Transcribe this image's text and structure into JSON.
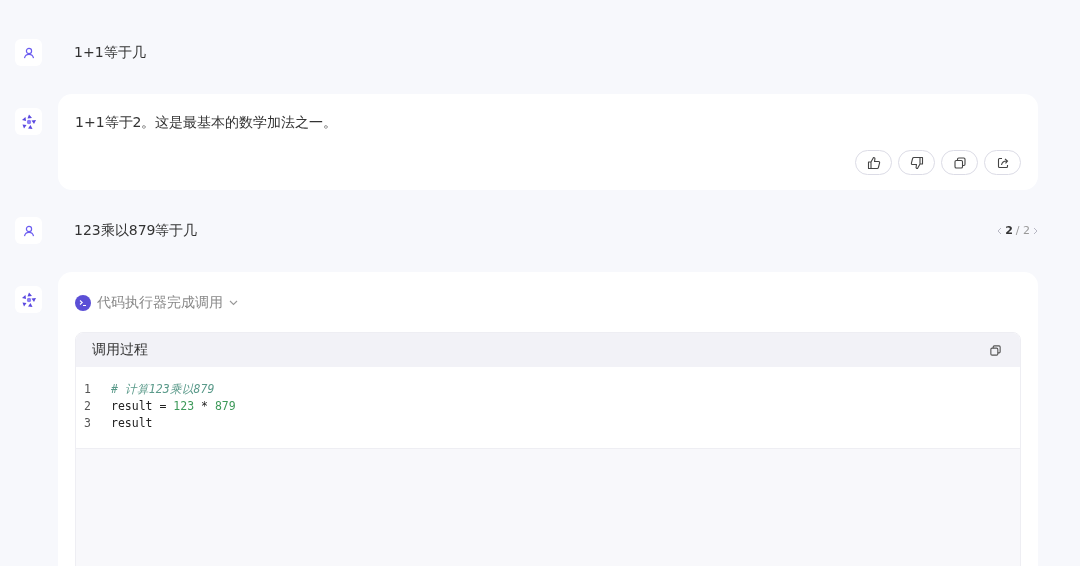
{
  "messages": [
    {
      "kind": "user",
      "text": "1+1等于几"
    },
    {
      "kind": "assistant",
      "text": "1+1等于2。这是最基本的数学加法之一。",
      "actions": [
        {
          "kind": "like"
        },
        {
          "kind": "dislike"
        },
        {
          "kind": "copy"
        },
        {
          "kind": "share"
        }
      ]
    },
    {
      "kind": "user",
      "text": "123乘以879等于几",
      "pager": {
        "current": "2",
        "total": "/ 2"
      }
    },
    {
      "kind": "assistant",
      "tool": {
        "status": "代码执行器完成调用",
        "expanded": true,
        "panel_title": "调用过程",
        "code": [
          {
            "number": "1",
            "tokens": [
              {
                "text": "# 计算123乘以879",
                "kind": "comment"
              }
            ]
          },
          {
            "number": "2",
            "tokens": [
              {
                "text": "result = ",
                "kind": "plain"
              },
              {
                "text": "123",
                "kind": "number"
              },
              {
                "text": " * ",
                "kind": "plain"
              },
              {
                "text": "879",
                "kind": "number"
              }
            ]
          },
          {
            "number": "3",
            "tokens": [
              {
                "text": "result",
                "kind": "plain"
              }
            ]
          }
        ]
      }
    }
  ]
}
